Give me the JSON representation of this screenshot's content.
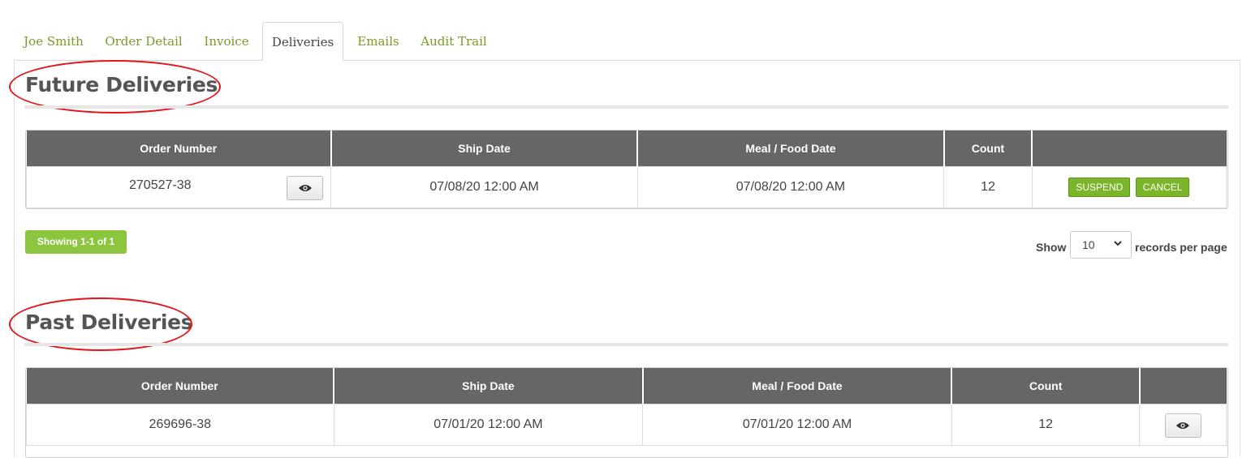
{
  "tabs": [
    {
      "label": "Joe Smith"
    },
    {
      "label": "Order Detail"
    },
    {
      "label": "Invoice"
    },
    {
      "label": "Deliveries"
    },
    {
      "label": "Emails"
    },
    {
      "label": "Audit Trail"
    }
  ],
  "active_tab": "Deliveries",
  "future": {
    "title": "Future Deliveries",
    "columns": [
      "Order Number",
      "Ship Date",
      "Meal / Food Date",
      "Count",
      ""
    ],
    "rows": [
      {
        "order_number": "270527-38",
        "ship_date": "07/08/20 12:00 AM",
        "meal_date": "07/08/20 12:00 AM",
        "count": "12",
        "suspend_label": "SUSPEND",
        "cancel_label": "CANCEL"
      }
    ],
    "showing": "Showing 1-1 of 1",
    "show_label": "Show",
    "page_size": "10",
    "records_label": "records per page"
  },
  "past": {
    "title": "Past Deliveries",
    "columns": [
      "Order Number",
      "Ship Date",
      "Meal / Food Date",
      "Count",
      ""
    ],
    "rows": [
      {
        "order_number": "269696-38",
        "ship_date": "07/01/20 12:00 AM",
        "meal_date": "07/01/20 12:00 AM",
        "count": "12"
      }
    ]
  },
  "colors": {
    "tab_link": "#7a9a2a",
    "header_bg": "#666666",
    "button_green": "#7ab52a",
    "badge_green": "#8cc63f",
    "annotation_red": "#e4141a"
  },
  "icons": {
    "view": "eye-icon",
    "dropdown": "chevron-down-icon"
  }
}
